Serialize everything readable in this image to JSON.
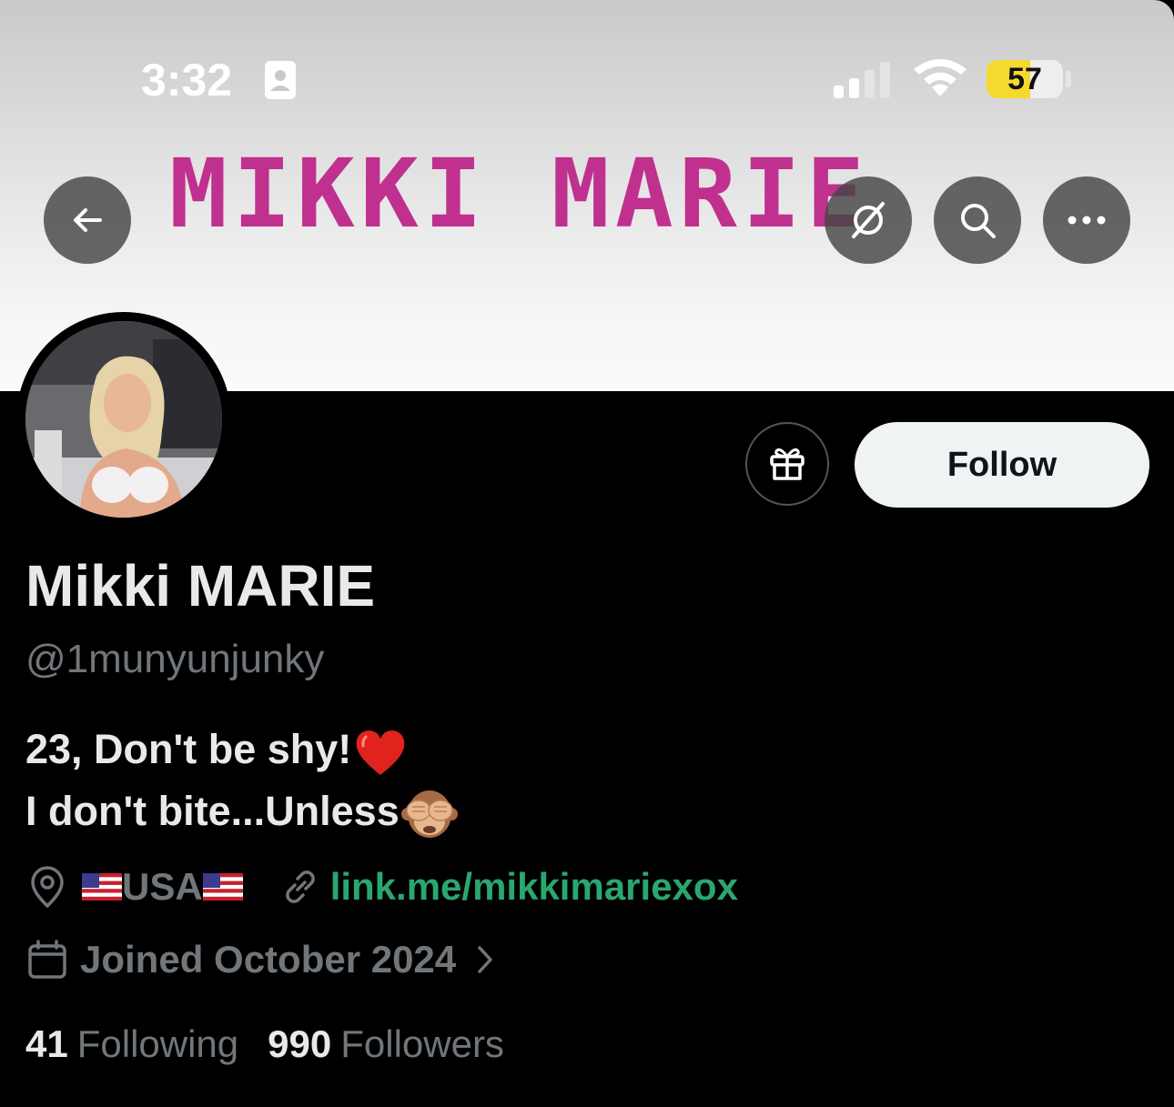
{
  "status_bar": {
    "time": "3:32",
    "battery": "57",
    "battery_level": 0.57
  },
  "banner": {
    "title": "MIKKI MARIE"
  },
  "nav": {
    "back_icon": "arrow-left-icon",
    "grok_icon": "grok-slash-circle-icon",
    "search_icon": "search-icon",
    "more_icon": "more-horizontal-icon"
  },
  "actions": {
    "gift_icon": "gift-icon",
    "follow_label": "Follow"
  },
  "profile": {
    "display_name": "Mikki MARIE",
    "handle": "@1munyunjunky",
    "bio_line1": "23, Don't be shy!",
    "bio_line2": "I don't bite...Unless",
    "location": "USA",
    "link": "link.me/mikkimariexox",
    "joined": "Joined October 2024",
    "following_count": "41",
    "following_label": "Following",
    "followers_count": "990",
    "followers_label": "Followers"
  },
  "colors": {
    "banner_text": "#c0308f",
    "link": "#2aa76f",
    "muted": "#71767b",
    "primary_text": "#e7e9ea",
    "battery_yellow": "#f4d92f"
  }
}
